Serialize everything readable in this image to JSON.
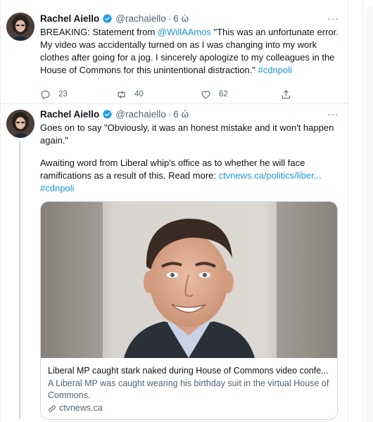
{
  "tweets": [
    {
      "author": {
        "name": "Rachel Aiello",
        "handle": "@rachaiello",
        "time": "6 ώ"
      },
      "text": {
        "prefix": "BREAKING: Statement from ",
        "mention": "@WillAAmos",
        "quote": " \"This was an unfortunate error. My video was accidentally turned on as I was changing into my work clothes after going for a jog. I sincerely apologize to my colleagues in the House of Commons for this unintentional distraction.\" ",
        "hashtag": "#cdnpoli"
      },
      "actions": {
        "replies": "23",
        "retweets": "40",
        "likes": "62"
      }
    },
    {
      "author": {
        "name": "Rachel Aiello",
        "handle": "@rachaiello",
        "time": "6 ώ"
      },
      "text": {
        "p1": "Goes on to say \"Obviously, it was an honest mistake and it won't happen again.\"",
        "p2": "Awaiting word from Liberal whip's office as to whether he will face ramifications as a result of this. Read more: ",
        "link": "ctvnews.ca/politics/liber...",
        "hashtag": "#cdnpoli"
      },
      "card": {
        "title": "Liberal MP caught stark naked during House of Commons video confe...",
        "description": "A Liberal MP was caught wearing his birthday suit in the virtual House of Commons.",
        "domain": "ctvnews.ca"
      }
    }
  ],
  "icons": [
    "verified-badge-icon",
    "more-icon",
    "reply-icon",
    "retweet-icon",
    "like-icon",
    "share-icon",
    "link-icon"
  ],
  "colors": {
    "accent": "#1b95e0",
    "text": "#0f1419",
    "secondary": "#536471",
    "border": "#e6ecf0"
  }
}
